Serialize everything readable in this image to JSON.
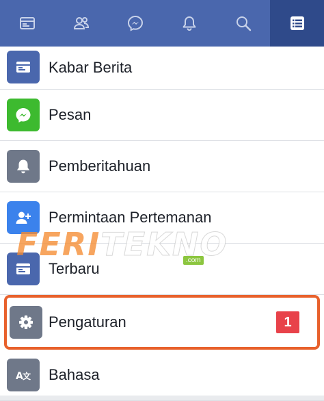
{
  "topbar": {
    "tabs": [
      {
        "icon": "news-feed-icon"
      },
      {
        "icon": "friends-icon"
      },
      {
        "icon": "messenger-icon"
      },
      {
        "icon": "bell-icon"
      },
      {
        "icon": "search-icon"
      },
      {
        "icon": "menu-list-icon",
        "active": true
      }
    ],
    "color": "#4a67ad",
    "active_color": "#2f4a8a"
  },
  "menu": {
    "items": [
      {
        "label": "Kabar Berita",
        "icon": "news-feed-icon",
        "color": "#4a67ad"
      },
      {
        "label": "Pesan",
        "icon": "messenger-icon",
        "color": "#3dba2f"
      },
      {
        "label": "Pemberitahuan",
        "icon": "bell-icon",
        "color": "#6f7889"
      },
      {
        "label": "Permintaan Pertemanan",
        "icon": "add-friend-icon",
        "color": "#3b82ec"
      },
      {
        "label": "Terbaru",
        "icon": "news-feed-icon",
        "color": "#4a67ad"
      },
      {
        "label": "Pengaturan",
        "icon": "gear-icon",
        "color": "#6f7889",
        "badge": "1"
      },
      {
        "label": "Bahasa",
        "icon": "language-icon",
        "color": "#6f7889"
      }
    ]
  },
  "watermark": {
    "part1": "FERI",
    "part2": "TEKNO",
    "suffix": ".com"
  }
}
